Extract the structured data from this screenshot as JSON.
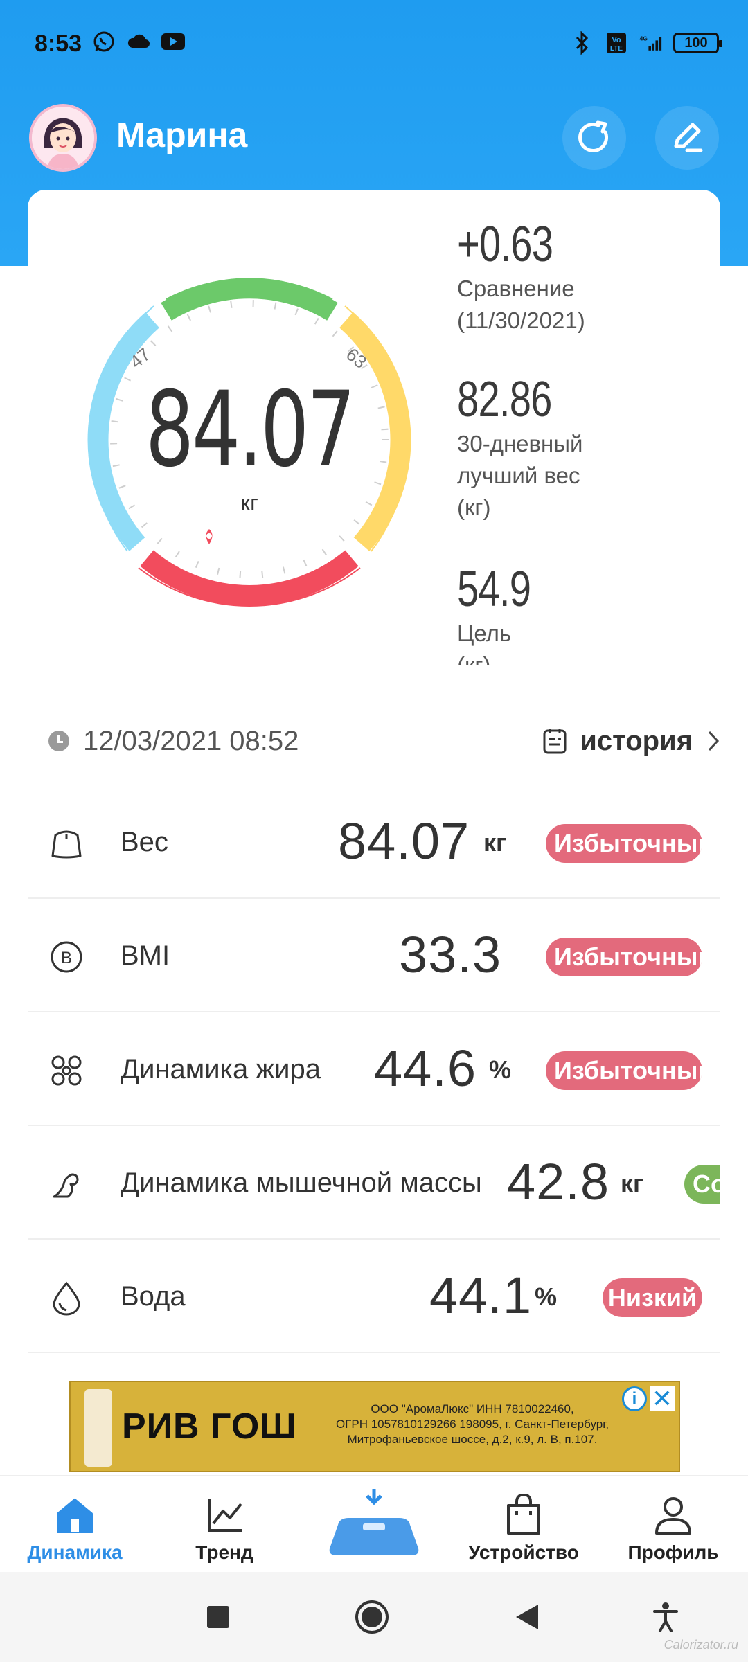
{
  "status_bar": {
    "time": "8:53",
    "left_icons": [
      "whatsapp-icon",
      "cloud-icon",
      "youtube-icon"
    ],
    "right_icons": [
      "bluetooth-icon",
      "volte-icon",
      "signal-4g-icon"
    ],
    "battery": "100"
  },
  "header": {
    "user_name": "Марина",
    "colors": {
      "background": "#1f9cf0"
    }
  },
  "gauge": {
    "value": "84.07",
    "unit": "кг",
    "range_low": "47",
    "range_high": "63",
    "colors": {
      "blue": "#8fdcf7",
      "green": "#6cc96a",
      "yellow": "#ffd969",
      "red": "#f24c5d"
    }
  },
  "stats": [
    {
      "value": "+0.63",
      "label_lines": [
        "Сравнение",
        "(11/30/2021)"
      ]
    },
    {
      "value": "82.86",
      "label_lines": [
        "30-дневный",
        "лучший вес",
        "(кг)"
      ]
    },
    {
      "value": "54.9",
      "label_lines": [
        "Цель",
        "(кг)"
      ]
    }
  ],
  "measurement": {
    "datetime": "12/03/2021 08:52",
    "history_label": "история"
  },
  "metrics": [
    {
      "name": "Вес",
      "value": "84.07",
      "unit": "кг",
      "badge": "Избыточный",
      "badge_color": "#e36a7c",
      "icon": "scale-weight-icon"
    },
    {
      "name": "BMI",
      "value": "33.3",
      "unit": "",
      "badge": "Избыточный",
      "badge_color": "#e36a7c",
      "icon": "bmi-icon"
    },
    {
      "name": "Динамика жира",
      "value": "44.6",
      "unit": "%",
      "badge": "Избыточный",
      "badge_color": "#e36a7c",
      "icon": "fat-icon"
    },
    {
      "name": "Динамика мышечной массы",
      "value": "42.8",
      "unit": "кг",
      "badge": "Совер",
      "badge_color": "#7cb65a",
      "icon": "muscle-icon"
    },
    {
      "name": "Вода",
      "value": "44.1",
      "unit": "%",
      "badge": "Низкий",
      "badge_color": "#e36a7c",
      "icon": "water-drop-icon"
    }
  ],
  "ad": {
    "brand": "РИВ ГОШ",
    "text_lines": [
      "ООО \"АромаЛюкс\" ИНН 7810022460,",
      "ОГРН 1057810129266 198095, г. Санкт-Петербург,",
      "Митрофаньевское шоссе, д.2, к.9, л. В, п.107."
    ],
    "info_label": "i",
    "close_label": "✕"
  },
  "bottom_nav": {
    "items": [
      {
        "label": "Динамика",
        "active": true
      },
      {
        "label": "Тренд",
        "active": false
      },
      {
        "label": "Устройство",
        "active": false
      },
      {
        "label": "Профиль",
        "active": false
      }
    ],
    "accent": "#2e8ee6"
  },
  "watermark": "Calorizator.ru"
}
